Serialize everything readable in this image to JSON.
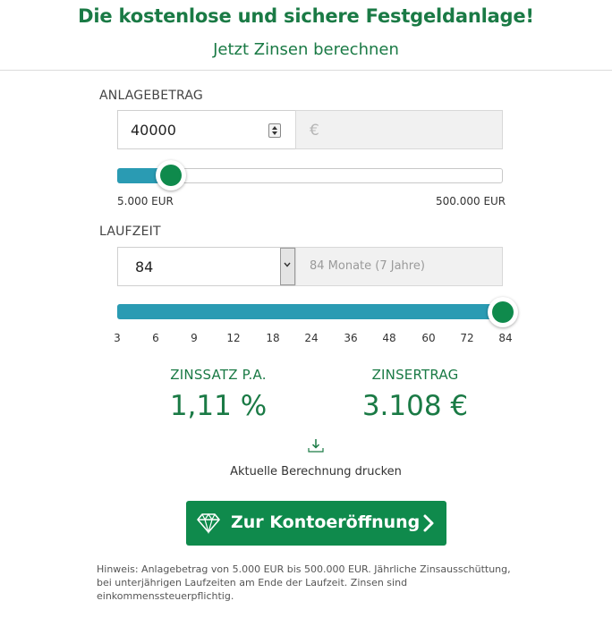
{
  "header": {
    "title": "Die kostenlose und sichere Festgeldanlage!",
    "subtitle": "Jetzt Zinsen berechnen"
  },
  "amount": {
    "label": "ANLAGEBETRAG",
    "value": "40000",
    "unit_placeholder": "€",
    "slider_min_label": "5.000 EUR",
    "slider_max_label": "500.000 EUR",
    "slider_value": 40000,
    "slider_min": 5000,
    "slider_max": 500000
  },
  "term": {
    "label": "LAUFZEIT",
    "value": "84",
    "unit_text": "84 Monate (7 Jahre)",
    "ticks": [
      "3",
      "6",
      "9",
      "12",
      "18",
      "24",
      "36",
      "48",
      "60",
      "72",
      "84"
    ],
    "selected_tick_index": 10
  },
  "results": {
    "rate_title": "ZINSSATZ P.A.",
    "rate_value": "1,11 %",
    "yield_title": "ZINSERTRAG",
    "yield_value": "3.108 €"
  },
  "print": {
    "label": "Aktuelle Berechnung drucken",
    "icon": "download-icon"
  },
  "cta": {
    "label": "Zur Kontoeröffnung",
    "icon": "diamond-icon"
  },
  "note": "Hinweis: Anlagebetrag von 5.000 EUR bis 500.000 EUR. Jährliche Zinsausschüttung, bei unterjährigen Laufzeiten am Ende der Laufzeit. Zinsen sind einkommenssteuerpflichtig.",
  "colors": {
    "brand_green": "#1a7a45",
    "button_green": "#0f8a4c",
    "slider_fill": "#2a9bb3"
  }
}
